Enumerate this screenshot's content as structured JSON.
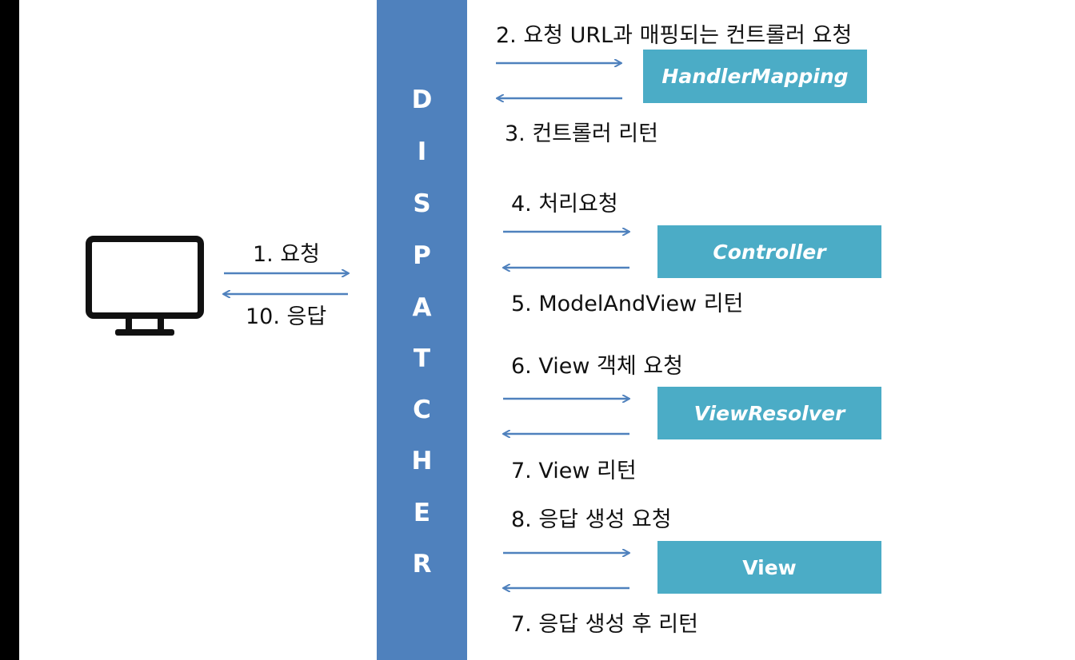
{
  "dispatcher": {
    "letters": [
      "D",
      "I",
      "S",
      "P",
      "A",
      "T",
      "C",
      "H",
      "E",
      "R"
    ],
    "color": "#4f81bd"
  },
  "client": {
    "icon": "monitor-icon",
    "request_label": "1. 요청",
    "response_label": "10. 응답"
  },
  "components": [
    {
      "name": "HandlerMapping",
      "request_label": "2. 요청 URL과 매핑되는 컨트롤러 요청",
      "return_label": "3. 컨트롤러 리턴"
    },
    {
      "name": "Controller",
      "request_label": "4. 처리요청",
      "return_label": "5. ModelAndView 리턴"
    },
    {
      "name": "ViewResolver",
      "request_label": "6. View 객체 요청",
      "return_label": "7. View 리턴"
    },
    {
      "name": "View",
      "request_label": "8. 응답 생성 요청",
      "return_label": "7. 응답 생성 후 리턴"
    }
  ],
  "colors": {
    "component_box": "#4bacc6",
    "arrow": "#4f81bd"
  }
}
